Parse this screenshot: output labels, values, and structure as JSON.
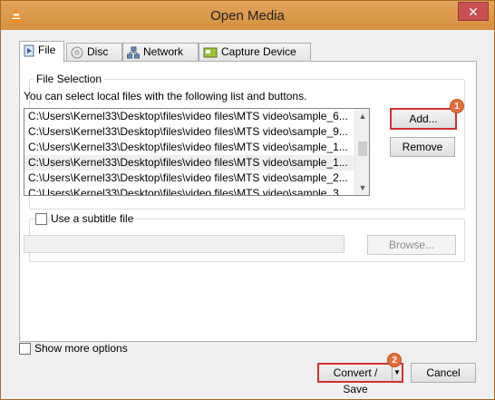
{
  "window": {
    "title": "Open Media",
    "close_glyph": "✕"
  },
  "tabs": [
    {
      "label": "File",
      "icon": "file-icon",
      "active": true
    },
    {
      "label": "Disc",
      "icon": "disc-icon",
      "active": false
    },
    {
      "label": "Network",
      "icon": "network-icon",
      "active": false
    },
    {
      "label": "Capture Device",
      "icon": "capture-device-icon",
      "active": false
    }
  ],
  "file_selection": {
    "title": "File Selection",
    "hint": "You can select local files with the following list and buttons.",
    "files": [
      "C:\\Users\\Kernel33\\Desktop\\files\\video files\\MTS video\\sample_6...",
      "C:\\Users\\Kernel33\\Desktop\\files\\video files\\MTS video\\sample_9...",
      "C:\\Users\\Kernel33\\Desktop\\files\\video files\\MTS video\\sample_1...",
      "C:\\Users\\Kernel33\\Desktop\\files\\video files\\MTS video\\sample_1...",
      "C:\\Users\\Kernel33\\Desktop\\files\\video files\\MTS video\\sample_2...",
      "C:\\Users\\Kernel33\\Desktop\\files\\video files\\MTS video\\sample_3..."
    ],
    "add_label": "Add...",
    "remove_label": "Remove"
  },
  "subtitle": {
    "checkbox_label": "Use a subtitle file",
    "browse_label": "Browse..."
  },
  "footer": {
    "show_more_label": "Show more options",
    "convert_label": "Convert / Save",
    "cancel_label": "Cancel"
  },
  "annotations": {
    "badge1": "1",
    "badge2": "2",
    "highlight_color": "#d32f2f",
    "badge_color": "#e36d3a"
  }
}
